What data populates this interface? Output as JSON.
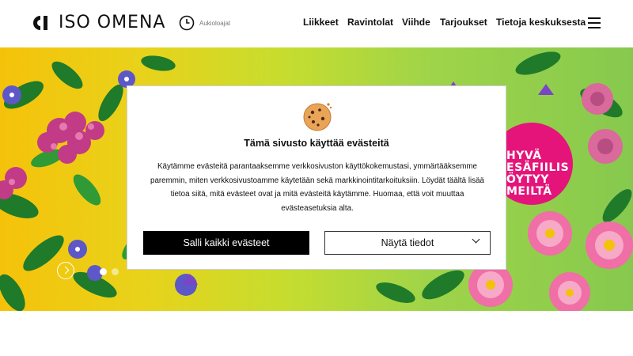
{
  "header": {
    "brand": "ISO OMENA",
    "hours_label": "Aukioloajat",
    "nav": [
      "Liikkeet",
      "Ravintolat",
      "Viihde",
      "Tarjoukset",
      "Tietoja keskuksesta"
    ]
  },
  "hero": {
    "badge_lines": [
      "HYVÄ",
      "ESÄFIILIS",
      "ÖYTYY",
      "MEILTÄ"
    ],
    "colors": {
      "badge": "#e5147a"
    }
  },
  "cookie_dialog": {
    "title": "Tämä sivusto käyttää evästeitä",
    "body_lines": [
      "Käytämme evästeitä parantaaksemme verkkosivuston käyttökokemustasi, ymmärtääksemme",
      "paremmin, miten verkkosivustoamme käytetään sekä markkinointitarkoituksiin.  Löydät täältä lisää",
      "tietoa siitä, mitä evästeet ovat ja mitä evästeitä käytämme.  Huomaa, että voit muuttaa",
      "evästeasetuksia alta."
    ],
    "allow_all_label": "Salli kaikki evästeet",
    "details_label": "Näytä tiedot"
  }
}
